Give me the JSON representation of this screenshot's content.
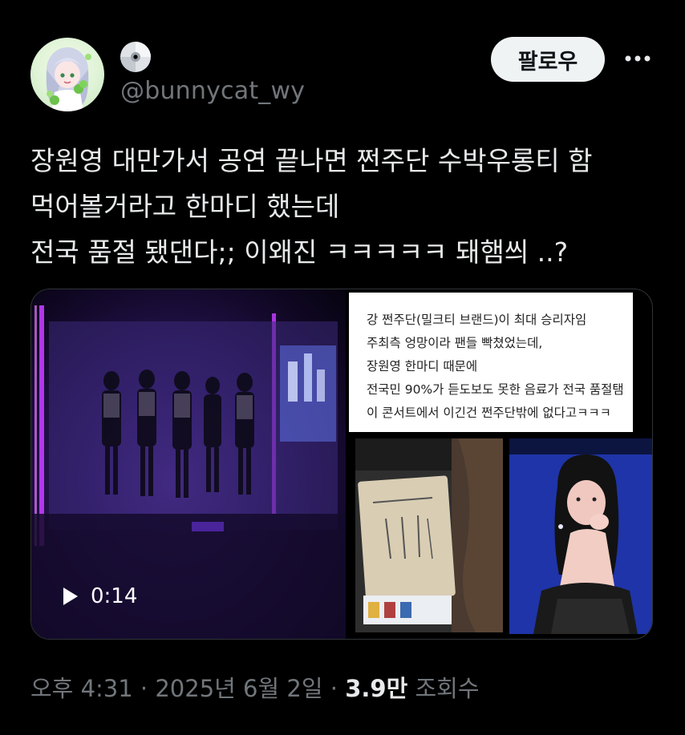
{
  "author": {
    "handle": "@bunnycat_wy",
    "avatar_icon": "anime-girl-avatar",
    "name_icon": "disc-icon"
  },
  "header": {
    "follow_label": "팔로우",
    "more_icon": "more-dots-icon"
  },
  "tweet": {
    "lines": [
      "장원영 대만가서 공연 끝나면 쩐주단 수박우롱티 함",
      "먹어볼거라고 한마디 했는데",
      "전국 품절 됐댄다;; 이왜진 ㅋㅋㅋㅋㅋ 돼햄씌 ..?"
    ]
  },
  "media": {
    "video": {
      "duration": "0:14",
      "play_icon": "play-icon"
    },
    "text_image_lines": [
      "강 쩐주단(밀크티 브랜드)이 최대 승리자임",
      "주최측 엉망이라 팬들 빡쳤었는데,",
      "장원영 한마디 때문에",
      "전국민 90%가 듣도보도 못한 음료가 전국 품절탬",
      "이 콘서트에서 이긴건 쩐주단밖에 없다고ㅋㅋㅋ"
    ]
  },
  "meta": {
    "time": "오후 4:31",
    "separator": " · ",
    "date": "2025년 6월 2일",
    "views": "3.9만",
    "views_label": " 조회수"
  },
  "colors": {
    "background": "#000000",
    "text": "#e7e9ea",
    "muted": "#71767b",
    "follow_bg": "#eff3f4"
  }
}
